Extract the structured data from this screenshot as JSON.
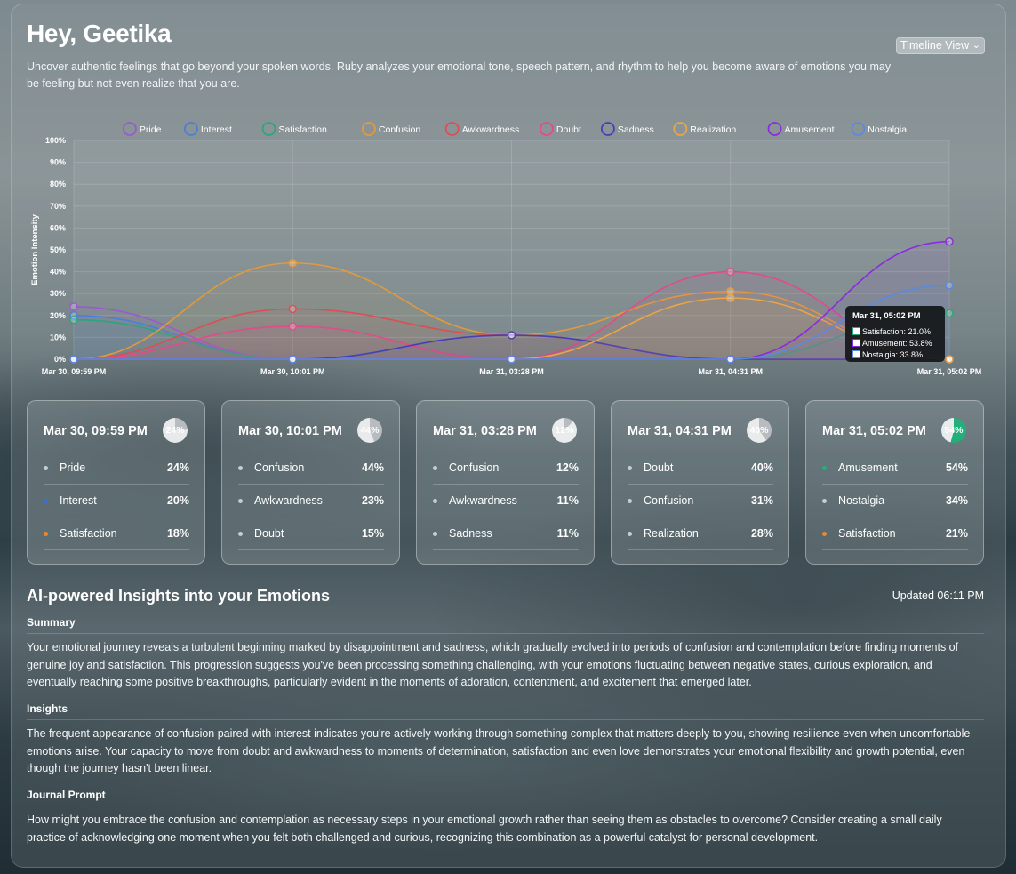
{
  "header": {
    "greeting": "Hey, Geetika",
    "intro": "Uncover authentic feelings that go beyond your spoken words. Ruby analyzes your emotional tone, speech pattern, and rhythm to help you become aware of emotions you may be feeling but not even realize that you are.",
    "view_select": "Timeline View"
  },
  "chart_data": {
    "type": "line",
    "ylabel": "Emotion Intensity",
    "ylim": [
      0,
      100
    ],
    "yticks": [
      "0%",
      "10%",
      "20%",
      "30%",
      "40%",
      "50%",
      "60%",
      "70%",
      "80%",
      "90%",
      "100%"
    ],
    "categories": [
      "Mar 30, 09:59 PM",
      "Mar 30, 10:01 PM",
      "Mar 31, 03:28 PM",
      "Mar 31, 04:31 PM",
      "Mar 31, 05:02 PM"
    ],
    "legend_position": "top",
    "series": [
      {
        "name": "Pride",
        "color": "#9b59d0",
        "values": [
          24,
          0,
          0,
          0,
          0
        ]
      },
      {
        "name": "Interest",
        "color": "#4a7fd6",
        "values": [
          20,
          0,
          0,
          0,
          0
        ]
      },
      {
        "name": "Satisfaction",
        "color": "#2aa67a",
        "values": [
          18,
          0,
          0,
          0,
          21
        ]
      },
      {
        "name": "Confusion",
        "color": "#e39a3b",
        "values": [
          0,
          44,
          11,
          31,
          0
        ]
      },
      {
        "name": "Awkwardness",
        "color": "#dc4e55",
        "values": [
          0,
          23,
          11,
          0,
          0
        ]
      },
      {
        "name": "Doubt",
        "color": "#e24b8a",
        "values": [
          0,
          15,
          0,
          40,
          0
        ]
      },
      {
        "name": "Sadness",
        "color": "#4540b8",
        "values": [
          0,
          0,
          11,
          0,
          0
        ]
      },
      {
        "name": "Realization",
        "color": "#e9a548",
        "values": [
          0,
          0,
          0,
          28,
          0
        ]
      },
      {
        "name": "Amusement",
        "color": "#8a2be2",
        "values": [
          0,
          0,
          0,
          0,
          53.8
        ]
      },
      {
        "name": "Nostalgia",
        "color": "#5a8ae0",
        "values": [
          0,
          0,
          0,
          0,
          33.8
        ]
      }
    ],
    "tooltip": {
      "title": "Mar 31, 05:02 PM",
      "rows": [
        {
          "label": "Satisfaction: 21.0%",
          "color": "#2aa67a"
        },
        {
          "label": "Amusement: 53.8%",
          "color": "#8a2be2"
        },
        {
          "label": "Nostalgia: 33.8%",
          "color": "#5a8ae0"
        }
      ]
    }
  },
  "cards": [
    {
      "time": "Mar 30, 09:59 PM",
      "top_pct": "24%",
      "top_value": 24,
      "accent": "#b8bcc0",
      "rows": [
        {
          "name": "Pride",
          "pct": "24%",
          "dot": "#c8cdd0"
        },
        {
          "name": "Interest",
          "pct": "20%",
          "dot": "#3b6fd8"
        },
        {
          "name": "Satisfaction",
          "pct": "18%",
          "dot": "#e8892f"
        }
      ]
    },
    {
      "time": "Mar 30, 10:01 PM",
      "top_pct": "44%",
      "top_value": 44,
      "accent": "#b8bcc0",
      "rows": [
        {
          "name": "Confusion",
          "pct": "44%",
          "dot": "#c8cdd0"
        },
        {
          "name": "Awkwardness",
          "pct": "23%",
          "dot": "#c8cdd0"
        },
        {
          "name": "Doubt",
          "pct": "15%",
          "dot": "#c8cdd0"
        }
      ]
    },
    {
      "time": "Mar 31, 03:28 PM",
      "top_pct": "12%",
      "top_value": 12,
      "accent": "#b8bcc0",
      "rows": [
        {
          "name": "Confusion",
          "pct": "12%",
          "dot": "#c8cdd0"
        },
        {
          "name": "Awkwardness",
          "pct": "11%",
          "dot": "#c8cdd0"
        },
        {
          "name": "Sadness",
          "pct": "11%",
          "dot": "#c8cdd0"
        }
      ]
    },
    {
      "time": "Mar 31, 04:31 PM",
      "top_pct": "40%",
      "top_value": 40,
      "accent": "#b8bcc0",
      "rows": [
        {
          "name": "Doubt",
          "pct": "40%",
          "dot": "#c8cdd0"
        },
        {
          "name": "Confusion",
          "pct": "31%",
          "dot": "#c8cdd0"
        },
        {
          "name": "Realization",
          "pct": "28%",
          "dot": "#c8cdd0"
        }
      ]
    },
    {
      "time": "Mar 31, 05:02 PM",
      "top_pct": "54%",
      "top_value": 54,
      "accent": "#22b07a",
      "rows": [
        {
          "name": "Amusement",
          "pct": "54%",
          "dot": "#22b07a"
        },
        {
          "name": "Nostalgia",
          "pct": "34%",
          "dot": "#c8cdd0"
        },
        {
          "name": "Satisfaction",
          "pct": "21%",
          "dot": "#e8892f"
        }
      ]
    }
  ],
  "insights": {
    "title": "AI-powered Insights into your Emotions",
    "updated": "Updated 06:11 PM",
    "summary_heading": "Summary",
    "summary": "Your emotional journey reveals a turbulent beginning marked by disappointment and sadness, which gradually evolved into periods of confusion and contemplation before finding moments of genuine joy and satisfaction. This progression suggests you've been processing something challenging, with your emotions fluctuating between negative states, curious exploration, and eventually reaching some positive breakthroughs, particularly evident in the moments of adoration, contentment, and excitement that emerged later.",
    "insights_heading": "Insights",
    "insights_text": "The frequent appearance of confusion paired with interest indicates you're actively working through something complex that matters deeply to you, showing resilience even when uncomfortable emotions arise. Your capacity to move from doubt and awkwardness to moments of determination, satisfaction and even love demonstrates your emotional flexibility and growth potential, even though the journey hasn't been linear.",
    "prompt_heading": "Journal Prompt",
    "prompt": "How might you embrace the confusion and contemplation as necessary steps in your emotional growth rather than seeing them as obstacles to overcome? Consider creating a small daily practice of acknowledging one moment when you felt both challenged and curious, recognizing this combination as a powerful catalyst for personal development."
  }
}
